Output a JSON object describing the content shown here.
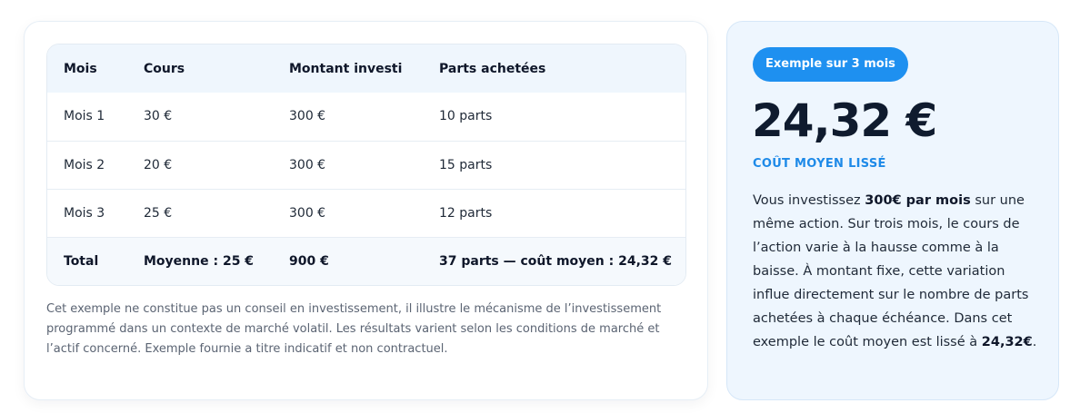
{
  "table": {
    "headers": [
      "Mois",
      "Cours",
      "Montant investi",
      "Parts achetées"
    ],
    "rows": [
      [
        "Mois 1",
        "30 €",
        "300 €",
        "10 parts"
      ],
      [
        "Mois 2",
        "20 €",
        "300 €",
        "15 parts"
      ],
      [
        "Mois 3",
        "25 €",
        "300 €",
        "12 parts"
      ]
    ],
    "total": [
      "Total",
      "Moyenne : 25 €",
      "900 €",
      "37 parts — coût moyen : 24,32 €"
    ]
  },
  "note": "Cet exemple ne constitue pas un conseil en investissement, il illustre le mécanisme de l’investissement programmé dans un contexte de marché volatil. Les résultats varient selon les conditions de marché et l’actif concerné. Exemple fournie a titre indicatif et non contractuel.",
  "summary": {
    "badge": "Exemple sur 3 mois",
    "value": "24,32 €",
    "label": "COÛT MOYEN LISSÉ",
    "desc_1": "Vous investissez ",
    "desc_2": "300€ par mois",
    "desc_3": " sur une même action. Sur trois mois, le cours de l’action varie à la hausse comme à la baisse. À montant fixe, cette variation influe directement sur le nombre de parts achetées à chaque échéance. Dans cet exemple le coût moyen est lissé à ",
    "desc_4": "24,32€",
    "desc_5": "."
  },
  "colors": {
    "accent": "#1e90f0",
    "panel_bg": "#eef6fe",
    "header_bg": "#eff6fd"
  }
}
